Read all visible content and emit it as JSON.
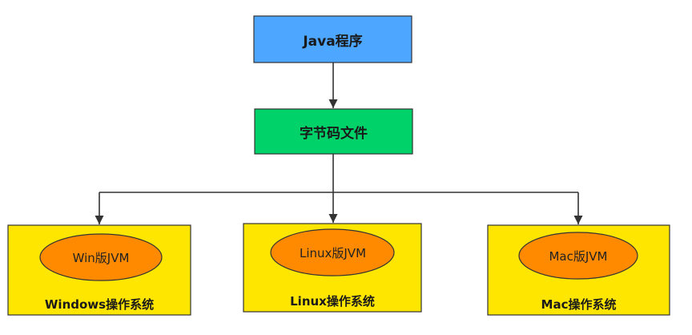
{
  "nodes": {
    "java_program": "Java程序",
    "bytecode_file": "字节码文件",
    "win_jvm": "Win版JVM",
    "linux_jvm": "Linux版JVM",
    "mac_jvm": "Mac版JVM",
    "windows_os": "Windows操作系统",
    "linux_os": "Linux操作系统",
    "mac_os": "Mac操作系统"
  },
  "colors": {
    "java_fill": "#4da6ff",
    "bytecode_fill": "#00d26a",
    "os_fill": "#ffe600",
    "jvm_fill": "#ff8a00",
    "line": "#333333"
  }
}
